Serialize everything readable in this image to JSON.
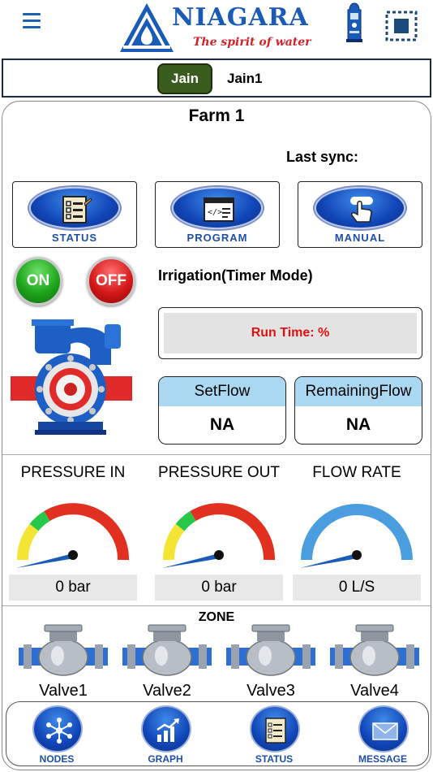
{
  "header": {
    "brand_name": "NIAGARA",
    "brand_tagline": "The spirit of water"
  },
  "tabs": [
    {
      "label": "Jain",
      "active": true
    },
    {
      "label": "Jain1",
      "active": false
    }
  ],
  "farm": {
    "title": "Farm 1",
    "last_sync_label": "Last sync:"
  },
  "mode_buttons": {
    "status": "STATUS",
    "program": "PROGRAM",
    "manual": "MANUAL"
  },
  "power": {
    "on_label": "ON",
    "off_label": "OFF"
  },
  "irrigation": {
    "mode_label": "Irrigation(Timer Mode)",
    "run_time_label": "Run Time: %"
  },
  "flow": {
    "set_flow_title": "SetFlow",
    "set_flow_value": "NA",
    "remaining_flow_title": "RemainingFlow",
    "remaining_flow_value": "NA"
  },
  "gauges": [
    {
      "title": "PRESSURE IN",
      "value": "0 bar",
      "level": 0
    },
    {
      "title": "PRESSURE OUT",
      "value": "0 bar",
      "level": 0
    },
    {
      "title": "FLOW RATE",
      "value": "0 L/S",
      "level": 0
    }
  ],
  "zone": {
    "title": "ZONE",
    "valves": [
      "Valve1",
      "Valve2",
      "Valve3",
      "Valve4"
    ]
  },
  "bottom_nav": {
    "nodes": "NODES",
    "graph": "GRAPH",
    "status": "STATUS",
    "message": "MESSAGE"
  },
  "colors": {
    "brand_blue": "#1a5bb8",
    "tagline_red": "#d2232a",
    "active_tab": "#3a5d1e",
    "run_time_text": "#e01010",
    "flow_header": "#a9d8f0",
    "gauge_red": "#e1301f",
    "gauge_yellow": "#f4e534",
    "gauge_green": "#27c84a",
    "gauge_blue": "#4a9ee0"
  }
}
